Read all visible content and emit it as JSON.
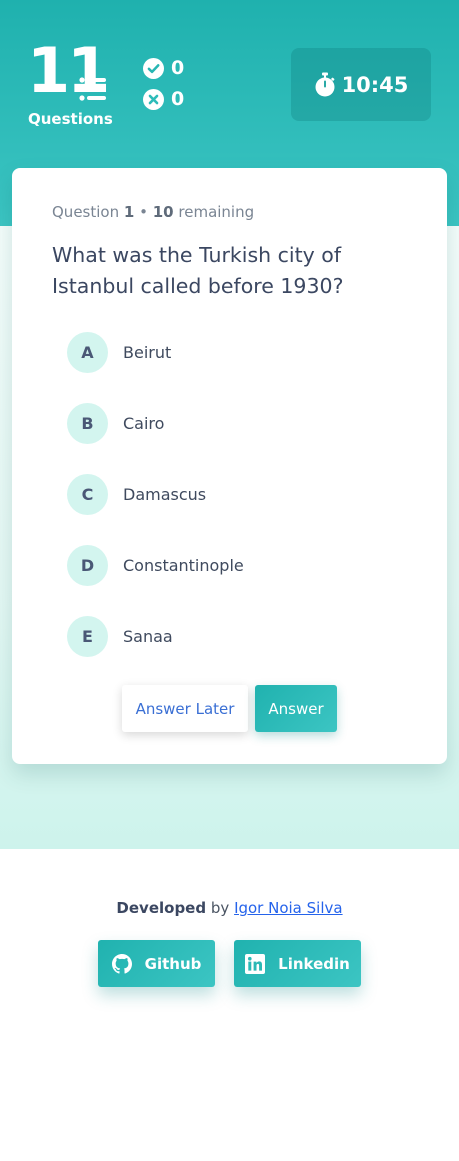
{
  "header": {
    "question_count": "11",
    "question_count_label": "Questions",
    "correct_count": "0",
    "wrong_count": "0",
    "timer": "10:45"
  },
  "quiz": {
    "meta_prefix": "Question",
    "current_question": "1",
    "separator": "•",
    "remaining_count": "10",
    "remaining_label": "remaining",
    "question": "What was the Turkish city of Istanbul called before 1930?",
    "options": [
      {
        "letter": "A",
        "label": "Beirut"
      },
      {
        "letter": "B",
        "label": "Cairo"
      },
      {
        "letter": "C",
        "label": "Damascus"
      },
      {
        "letter": "D",
        "label": "Constantinople"
      },
      {
        "letter": "E",
        "label": "Sanaa"
      }
    ],
    "answer_later_label": "Answer Later",
    "answer_label": "Answer"
  },
  "footer": {
    "developed_label": "Developed",
    "by_label": "by",
    "author_name": "Igor Noia Silva",
    "github_label": "Github",
    "linkedin_label": "Linkedin"
  },
  "colors": {
    "accent": "#20b2af",
    "accent_light": "#3cc5c3",
    "option_circle": "#d3f5ef",
    "link": "#2563eb"
  },
  "icons": [
    "list-icon",
    "check-circle-icon",
    "x-circle-icon",
    "stopwatch-icon",
    "github-icon",
    "linkedin-icon"
  ]
}
